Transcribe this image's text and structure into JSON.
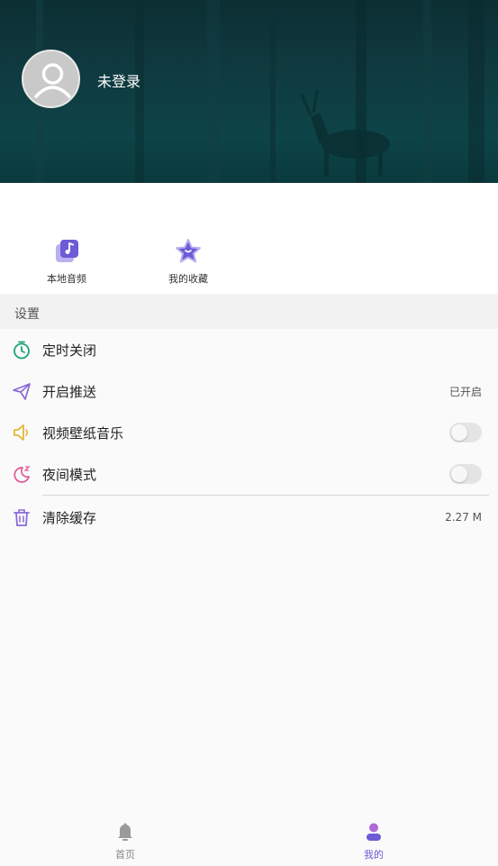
{
  "header": {
    "login_status": "未登录"
  },
  "quick_actions": [
    {
      "label": "本地音频",
      "icon": "music-note-icon"
    },
    {
      "label": "我的收藏",
      "icon": "star-icon"
    }
  ],
  "settings": {
    "title": "设置",
    "items": [
      {
        "label": "定时关闭",
        "icon": "timer-icon"
      },
      {
        "label": "开启推送",
        "icon": "send-icon",
        "value": "已开启"
      },
      {
        "label": "视频壁纸音乐",
        "icon": "speaker-icon",
        "toggle": false
      },
      {
        "label": "夜间模式",
        "icon": "moon-icon",
        "toggle": false
      },
      {
        "label": "清除缓存",
        "icon": "trash-icon",
        "value": "2.27 M"
      }
    ]
  },
  "bottom_nav": [
    {
      "label": "首页",
      "icon": "bell-icon",
      "active": false
    },
    {
      "label": "我的",
      "icon": "profile-icon",
      "active": true
    }
  ],
  "colors": {
    "accent_purple": "#6b5bd6",
    "timer_green": "#1ea37a",
    "send_purple": "#8a6ad8",
    "speaker_yellow": "#e4b83a",
    "moon_pink": "#e0609a"
  }
}
